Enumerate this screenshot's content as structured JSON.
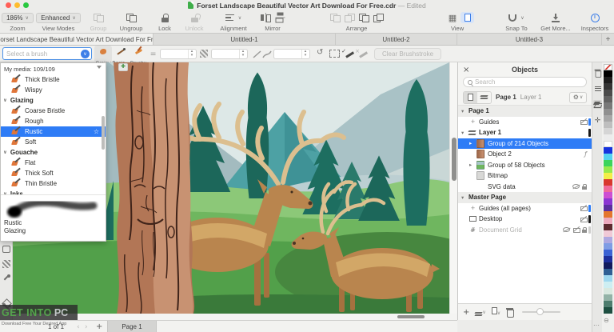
{
  "window": {
    "doc_title": "Forset Landscape Beautiful Vector Art Download For Free.cdr",
    "edited": "— Edited"
  },
  "toolbar": {
    "zoom": {
      "value": "186%",
      "label": "Zoom"
    },
    "view_modes": {
      "value": "Enhanced",
      "label": "View Modes"
    },
    "group": "Group",
    "ungroup": "Ungroup",
    "lock": "Lock",
    "unlock": "Unlock",
    "alignment": "Alignment",
    "mirror": "Mirror",
    "arrange": "Arrange",
    "view": "View",
    "snap_to": "Snap To",
    "get_more": "Get More...",
    "inspectors": "Inspectors"
  },
  "tabs": {
    "active": "Forset Landscape Beautiful Vector Art Download For Fr..",
    "others": [
      "Untitled-1",
      "Untitled-2",
      "Untitled-3"
    ]
  },
  "property_bar": {
    "brush_placeholder": "Select a brush",
    "presets": [
      "Grainy",
      "Basic...",
      "Brushy"
    ],
    "clear_button": "Clear Brushstroke"
  },
  "brush_panel": {
    "header": "My media: 109/109",
    "items": [
      {
        "type": "item",
        "label": "Thick Bristle"
      },
      {
        "type": "item",
        "label": "Wispy"
      },
      {
        "type": "category",
        "label": "Glazing"
      },
      {
        "type": "item",
        "label": "Coarse Bristle"
      },
      {
        "type": "item",
        "label": "Rough"
      },
      {
        "type": "item",
        "label": "Rustic",
        "selected": true
      },
      {
        "type": "item",
        "label": "Soft"
      },
      {
        "type": "category",
        "label": "Gouache"
      },
      {
        "type": "item",
        "label": "Flat"
      },
      {
        "type": "item",
        "label": "Thick Soft"
      },
      {
        "type": "item",
        "label": "Thin Bristle"
      },
      {
        "type": "category",
        "label": "Inks"
      }
    ],
    "preview_labels": [
      "Rustic",
      "Glazing"
    ]
  },
  "objects_panel": {
    "title": "Objects",
    "search_placeholder": "Search",
    "active_page": "Page 1",
    "active_layer": "Layer 1",
    "rows": [
      {
        "label": "Page 1"
      },
      {
        "label": "Guides"
      },
      {
        "label": "Layer 1"
      },
      {
        "label": "Group of 214 Objects"
      },
      {
        "label": "Object 2"
      },
      {
        "label": "Group of 58 Objects"
      },
      {
        "label": "Bitmap"
      },
      {
        "label": "SVG data"
      },
      {
        "label": "Master Page"
      },
      {
        "label": "Guides (all pages)"
      },
      {
        "label": "Desktop"
      },
      {
        "label": "Document Grid"
      }
    ]
  },
  "palette": {
    "colors": [
      "none",
      "#000000",
      "#1d1d1d",
      "#343434",
      "#4b4b4b",
      "#626262",
      "#797979",
      "#909090",
      "#a7a7a7",
      "#bebebe",
      "#d5d5d5",
      "#ececec",
      "#ffffff",
      "#1733dd",
      "#54d2f0",
      "#3bd45c",
      "#97e94c",
      "#f2ee48",
      "#d8382e",
      "#ef6a9a",
      "#cd4ed2",
      "#8c36d2",
      "#5c2f9e",
      "#e4762e",
      "#edaabd",
      "#5d2a2e",
      "#f0c9d6",
      "#aea8e0",
      "#7f9ce4",
      "#3b62d4",
      "#1d2f9c",
      "#111b5e",
      "#2f5f94",
      "#9ed7ef",
      "#cdeef2",
      "#d8e8df",
      "#93b3a7",
      "#4e7d6e",
      "#1e4f41"
    ]
  },
  "status_bar": {
    "pages": "1 of 1",
    "page_tab": "Page 1"
  },
  "watermark": {
    "brand_a": "GET INTO",
    "brand_b": "PC",
    "tagline": "Download Free Your Desired App"
  },
  "artwork_alt": "Vector landscape: two elk with tan antlers facing each other in a green meadow with teal pine and cypress trees, blue-gray mountains, and a carved wooden tree trunk in the left foreground",
  "icons": {
    "chevron_down": "∨",
    "disclosure_open": "▾",
    "disclosure_closed": "▸",
    "close": "×",
    "star": "☆",
    "gear": "⚙",
    "grid_view": "▦",
    "plus": "+",
    "nav_prev": "‹",
    "nav_next": "›",
    "ellipsis": "…",
    "collapse": "⊖",
    "hash": "#",
    "fx": "ƒ",
    "stepper_up": "▴",
    "stepper_down": "▾",
    "undo": "↺",
    "check": "✓",
    "cross": "×"
  }
}
